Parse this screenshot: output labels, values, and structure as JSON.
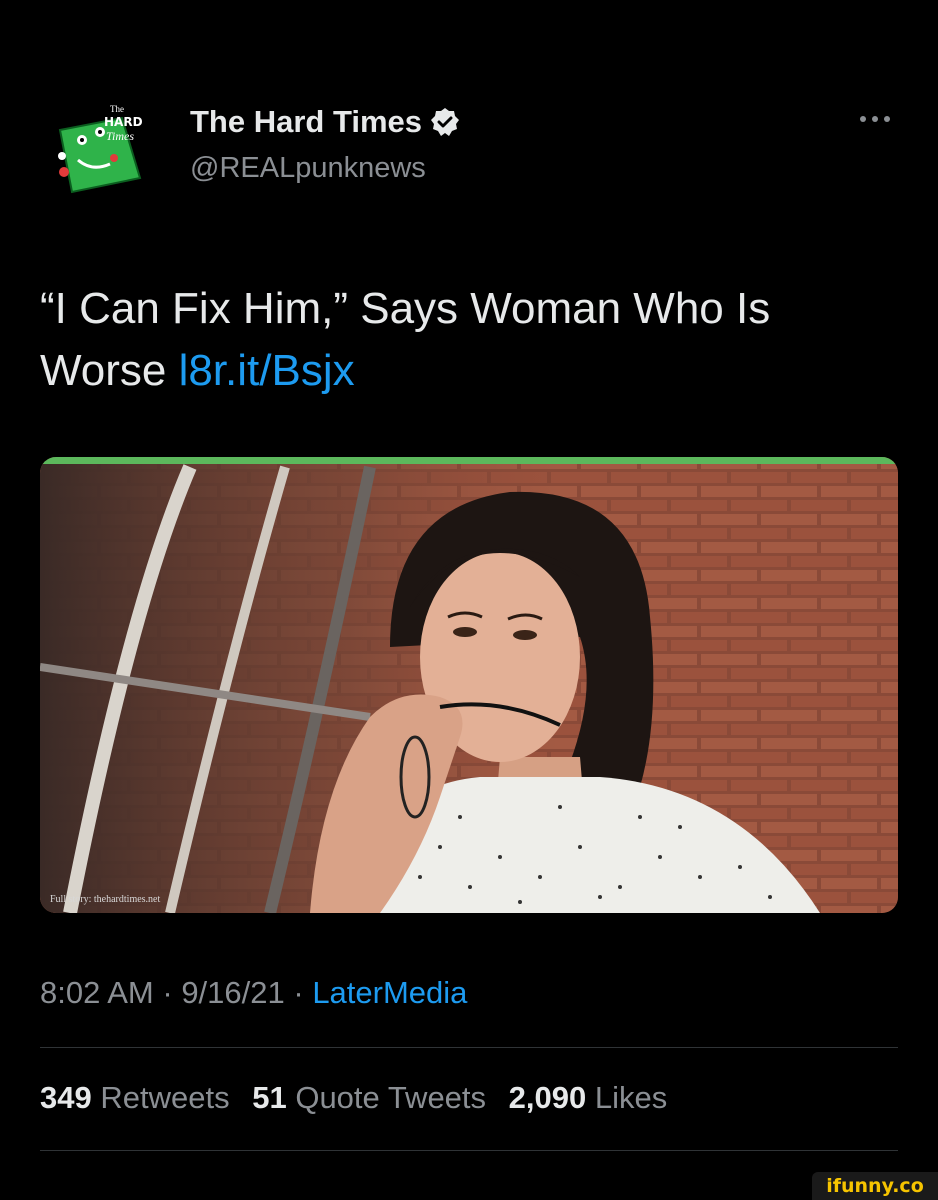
{
  "author": {
    "display_name": "The Hard Times",
    "handle": "@REALpunknews",
    "verified": true,
    "avatar_icon": "hard-times-logo"
  },
  "more_icon": "ellipsis-icon",
  "tweet": {
    "text_main": "“I Can Fix Him,” Says Woman Who Is Worse",
    "link_text": "l8r.it/Bsjx"
  },
  "media": {
    "caption": "Full story: thehardtimes.net",
    "accent_color": "#5cb85c"
  },
  "meta": {
    "time": "8:02 AM",
    "date": "9/16/21",
    "source": "LaterMedia",
    "separator": " · "
  },
  "stats": {
    "retweets_count": "349",
    "retweets_label": "Retweets",
    "quotes_count": "51",
    "quotes_label": "Quote Tweets",
    "likes_count": "2,090",
    "likes_label": "Likes"
  },
  "watermark": "ifunny.co",
  "colors": {
    "link": "#1d9bf0",
    "muted": "#8b8f94",
    "text": "#e7e9ea",
    "background": "#000000"
  }
}
